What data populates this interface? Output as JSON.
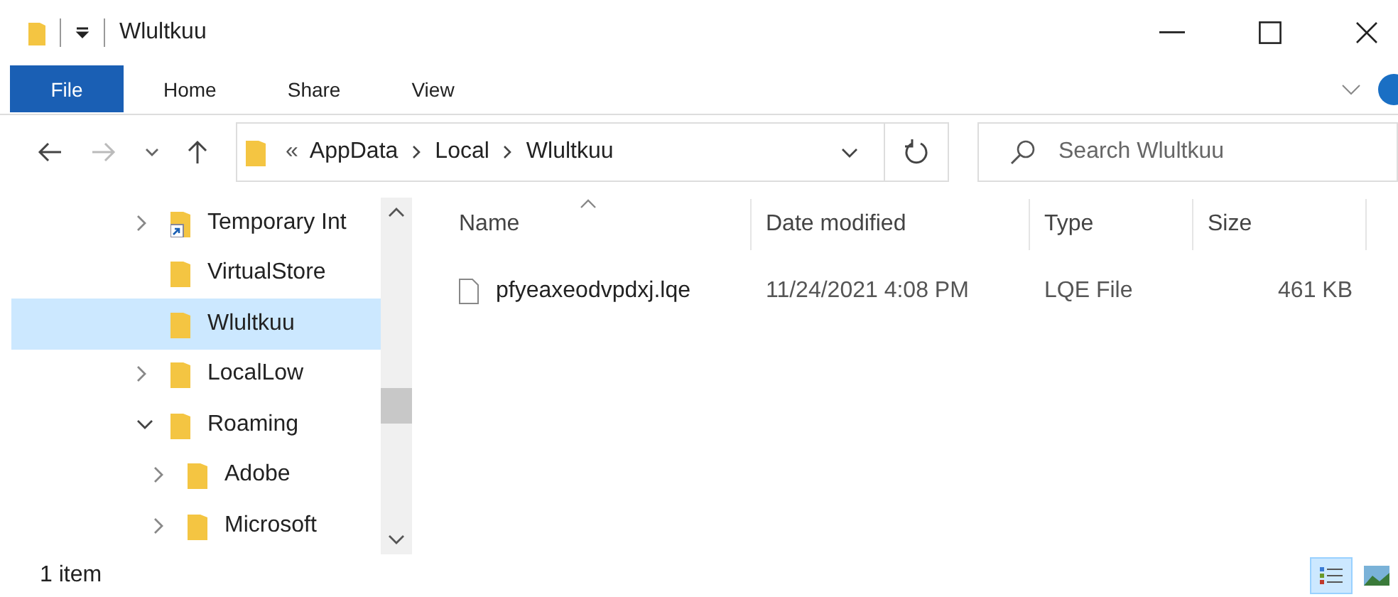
{
  "window": {
    "title": "Wlultkuu"
  },
  "ribbon_tabs": [
    {
      "label": "File",
      "kind": "file",
      "selected": false
    },
    {
      "label": "Home",
      "kind": "tab",
      "selected": false
    },
    {
      "label": "Share",
      "kind": "tab",
      "selected": false
    },
    {
      "label": "View",
      "kind": "tab",
      "selected": false
    }
  ],
  "address": {
    "overflow": "«",
    "crumbs": [
      "AppData",
      "Local",
      "Wlultkuu"
    ]
  },
  "search": {
    "placeholder": "Search Wlultkuu"
  },
  "nav": {
    "items": [
      {
        "children": [
          {
            "label": "Temporary Int",
            "has_children": true,
            "expanded": false,
            "shortcut": true,
            "selected": false
          },
          {
            "label": "VirtualStore",
            "has_children": false,
            "expanded": false,
            "shortcut": false,
            "selected": false
          },
          {
            "label": "Wlultkuu",
            "has_children": false,
            "expanded": false,
            "shortcut": false,
            "selected": true
          }
        ]
      },
      {
        "label": "LocalLow",
        "has_children": true,
        "expanded": false,
        "shortcut": false,
        "selected": false
      },
      {
        "label": "Roaming",
        "has_children": true,
        "expanded": true,
        "shortcut": false,
        "selected": false,
        "children": [
          {
            "label": "Adobe",
            "has_children": true,
            "expanded": false,
            "shortcut": false,
            "selected": false
          },
          {
            "label": "Microsoft",
            "has_children": true,
            "expanded": false,
            "shortcut": false,
            "selected": false
          }
        ]
      }
    ]
  },
  "table": {
    "columns": [
      {
        "label": "Name",
        "sorted": true
      },
      {
        "label": "Date modified",
        "sorted": false
      },
      {
        "label": "Type",
        "sorted": false
      },
      {
        "label": "Size",
        "sorted": false
      }
    ],
    "rows": [
      {
        "cells": [
          "pfyeaxeodvpdxj.lqe",
          "11/24/2021 4:08 PM",
          "LQE File",
          "461 KB"
        ],
        "selected": false
      }
    ]
  },
  "status_bar": {
    "text": "1 item"
  },
  "view_buttons": [
    {
      "kind": "details",
      "selected": true
    },
    {
      "kind": "large_icons",
      "selected": false
    }
  ]
}
